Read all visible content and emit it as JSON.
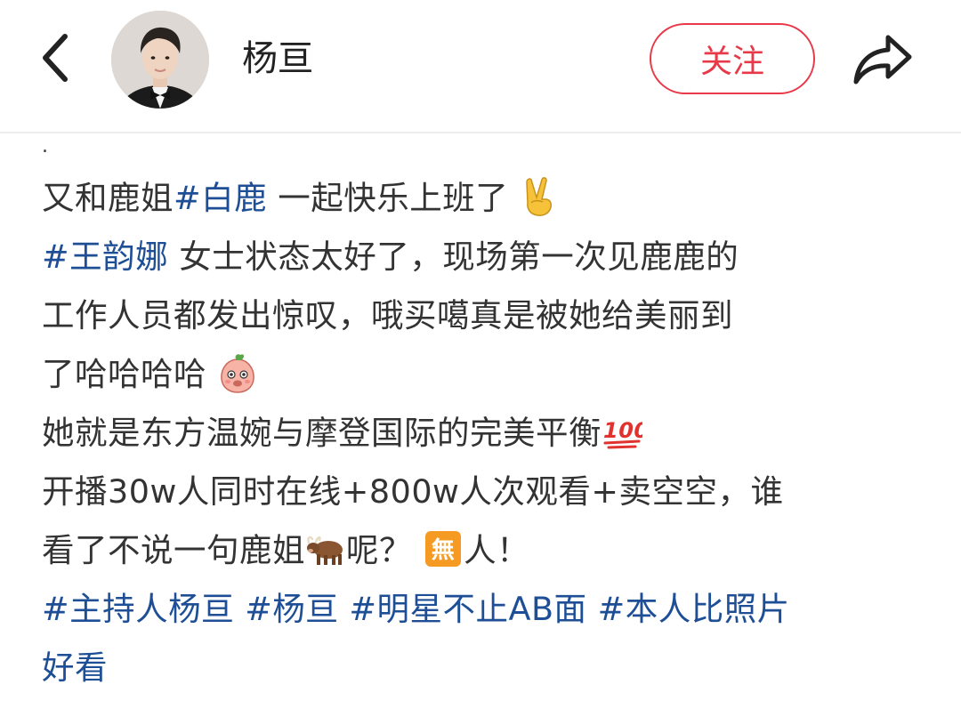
{
  "header": {
    "username": "杨亘",
    "follow_label": "关注",
    "back_icon": "chevron-left-icon",
    "share_icon": "share-arrow-icon"
  },
  "colors": {
    "accent_red": "#e8394a",
    "hashtag_blue": "#1e4f96",
    "text": "#333333"
  },
  "post": {
    "dot": ".",
    "line1": {
      "a": "又和鹿姐",
      "tag": "#白鹿",
      "b": " 一起快乐上班了",
      "emoji": "victory-hand-emoji"
    },
    "line2": {
      "tag": "#王韵娜",
      "b": " 女士状态太好了，现场第一次见鹿鹿的"
    },
    "line3": {
      "a": "工作人员都发出惊叹，哦买噶真是被她给美丽到"
    },
    "line4": {
      "a": "了哈哈哈哈",
      "emoji": "peach-face-emoji"
    },
    "line5": {
      "a": "她就是东方温婉与摩登国际的完美平衡",
      "emoji": "hundred-points-emoji"
    },
    "line6": {
      "a": "开播30w人同时在线+800w人次观看+卖空空，谁"
    },
    "line7": {
      "a": "看了不说一句鹿姐",
      "emoji1": "ox-emoji",
      "b": "呢？",
      "emoji2": "no-sign-emoji",
      "c": "人！"
    },
    "line8": {
      "tag1": "#主持人杨亘",
      "tag2": "#杨亘",
      "tag3": "#明星不止AB面",
      "tag4": "#本人比照片"
    },
    "line9": {
      "tag": "好看"
    }
  }
}
